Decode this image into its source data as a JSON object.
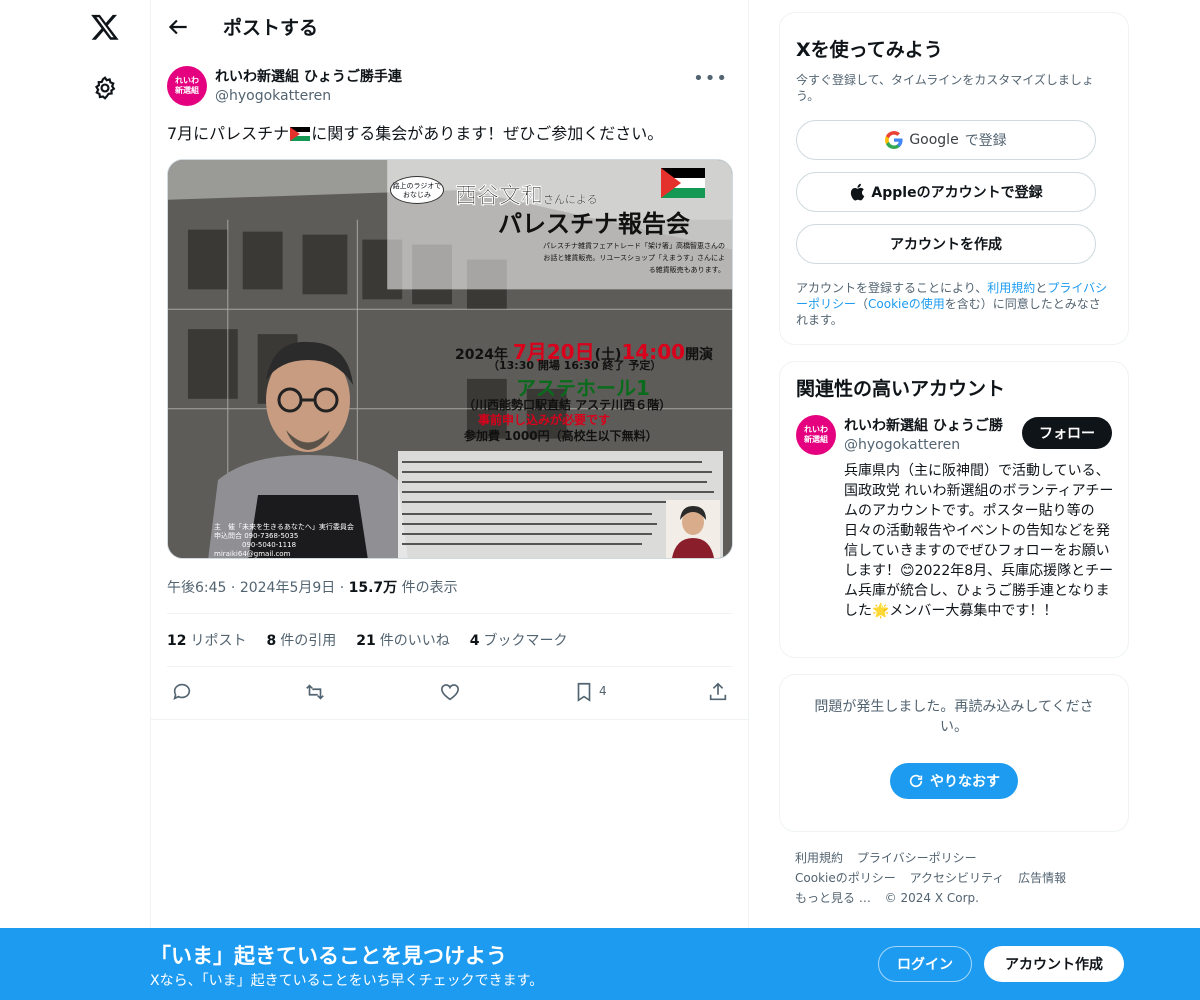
{
  "nav": {
    "logo_icon": "x-logo-icon",
    "settings_icon": "gear-icon"
  },
  "header": {
    "back_icon": "arrow-left-icon",
    "title": "ポストする"
  },
  "post": {
    "avatar_text": [
      "れいわ",
      "新選組"
    ],
    "author_name": "れいわ新選組 ひょうご勝手連",
    "author_handle": "@hyogokatteren",
    "text_before_flag": "7月にパレスチナ",
    "text_after_flag": "に関する集会があります！ぜひご参加ください。",
    "poster": {
      "bubble": "路上のラジオで おなじみ",
      "title_main": "西谷文和",
      "title_suffix": "さんによる",
      "title_line2": "パレスチナ報告会",
      "blurb": "パレスチナ雑貨フェアトレード「架け箸」高橋智恵さんのお話と雑貨販売。リユースショップ「えまうす」さんによる雑貨販売もあります。",
      "date_prefix": "2024年",
      "date_main": "7月20日",
      "date_day": "(土)",
      "date_time": "14:00",
      "date_suffix": "開演",
      "time_detail": "（13:30 開場 16:30 終了 予定）",
      "hall": "アステホール1",
      "access": "（川西能勢口駅直結 アステ川西６階）",
      "reservation": "事前申し込みが必要です",
      "fee": "参加費 1000円（高校生以下無料）",
      "organizer": "主　催「未来を生きるあなたへ」実行委員会\n申込問合 090-7368-5035\n　　　　090-5040-1118\nmiraiki64@gmail.com"
    },
    "time": "午後6:45",
    "date": "2024年5月9日",
    "views_count": "15.7万",
    "views_label": "件の表示",
    "stats": [
      {
        "count": "12",
        "label": "リポスト"
      },
      {
        "count": "8",
        "label": "件の引用"
      },
      {
        "count": "21",
        "label": "件のいいね"
      },
      {
        "count": "4",
        "label": "ブックマーク"
      }
    ],
    "bookmark_count": "4",
    "more_icon": "more-icon"
  },
  "signup_card": {
    "title": "Xを使ってみよう",
    "subtitle": "今すぐ登録して、タイムラインをカスタマイズしましょう。",
    "google_label": "Google",
    "google_suffix": "で登録",
    "apple_label": "Appleのアカウントで登録",
    "create_label": "アカウントを作成",
    "legal_1": "アカウントを登録することにより、",
    "legal_terms": "利用規約",
    "legal_and": "と",
    "legal_privacy": "プライバシーポリシー",
    "legal_paren_open": "（",
    "legal_cookie": "Cookieの使用",
    "legal_2": "を含む）に同意したとみなされます。"
  },
  "related": {
    "title": "関連性の高いアカウント",
    "name": "れいわ新選組 ひょうご勝",
    "handle": "@hyogokatteren",
    "follow_label": "フォロー",
    "bio": "兵庫県内（主に阪神間）で活動している、国政政党 れいわ新選組のボランティアチームのアカウントです。ポスター貼り等の日々の活動報告やイベントの告知などを発信していきますのでぜひフォローをお願いします！😊2022年8月、兵庫応援隊とチーム兵庫が統合し、ひょうご勝手連となりました🌟メンバー大募集中です！！"
  },
  "error_card": {
    "text": "問題が発生しました。再読み込みしてください。",
    "retry_label": "やりなおす"
  },
  "footer": {
    "links": [
      "利用規約",
      "プライバシーポリシー",
      "Cookieのポリシー",
      "アクセシビリティ",
      "広告情報",
      "もっと見る …"
    ],
    "copyright": "© 2024 X Corp."
  },
  "bottom_bar": {
    "title": "「いま」起きていることを見つけよう",
    "subtitle": "Xなら、「いま」起きていることをいち早くチェックできます。",
    "login_label": "ログイン",
    "signup_label": "アカウント作成"
  },
  "colors": {
    "accent": "#1d9bf0",
    "text": "#0f1419",
    "muted": "#536471",
    "border": "#eff3f4",
    "avatar": "#e4007f"
  }
}
